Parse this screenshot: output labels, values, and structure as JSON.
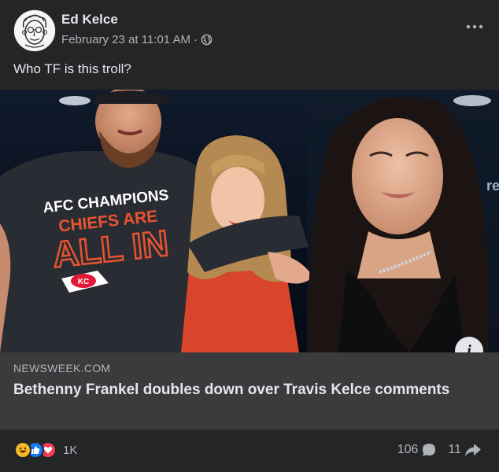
{
  "post": {
    "author": "Ed Kelce",
    "timestamp": "February 23 at 11:01 AM",
    "separator": "·",
    "privacy_icon": "globe-icon",
    "more_icon": "more-options-icon",
    "caption": "Who TF is this troll?"
  },
  "image": {
    "shirt_line1": "AFC CHAMPIONS",
    "shirt_line2": "CHIEFS ARE",
    "shirt_line3": "ALL IN",
    "shirt_logo": "KC",
    "bg_sign": "re"
  },
  "link": {
    "domain": "NEWSWEEK.COM",
    "headline": "Bethenny Frankel doubles down over Travis Kelce comments",
    "info_label": "i"
  },
  "footer": {
    "reaction_icons": [
      "haha-icon",
      "like-icon",
      "love-icon"
    ],
    "reaction_count": "1K",
    "comment_count": "106",
    "share_count": "11"
  },
  "colors": {
    "background": "#242526",
    "link_card": "#3a3b3c",
    "text_primary": "#e4e6eb",
    "text_secondary": "#b0b3b8",
    "like_blue": "#1877f2",
    "love_red": "#f33e58",
    "haha_yellow": "#f7b928"
  }
}
